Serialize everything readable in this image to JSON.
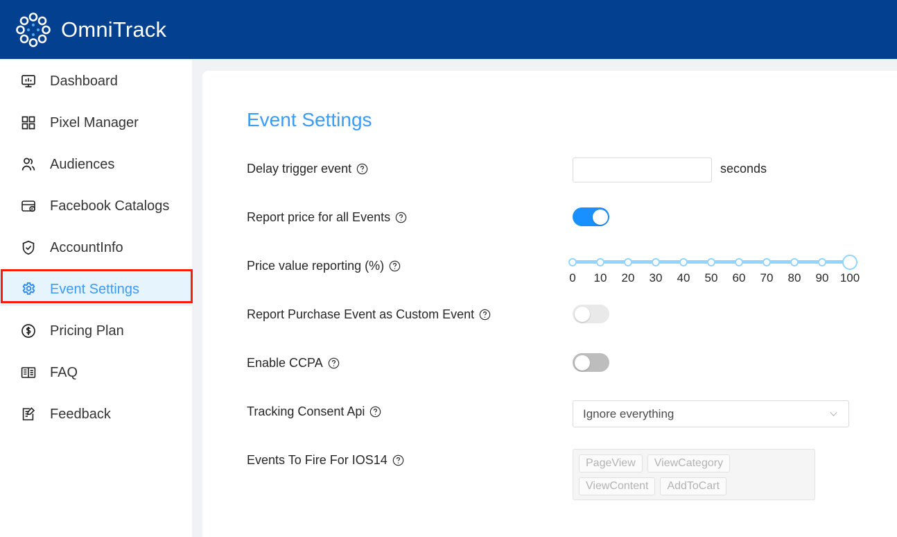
{
  "header": {
    "brand": "OmniTrack",
    "logo_icon": "dotted-ring-logo-icon",
    "bg_color": "#034190"
  },
  "sidebar": {
    "items": [
      {
        "label": "Dashboard",
        "icon": "monitor-chart-icon",
        "active": false
      },
      {
        "label": "Pixel Manager",
        "icon": "grid-squares-icon",
        "active": false
      },
      {
        "label": "Audiences",
        "icon": "people-icon",
        "active": false
      },
      {
        "label": "Facebook Catalogs",
        "icon": "catalog-facebook-icon",
        "active": false
      },
      {
        "label": "AccountInfo",
        "icon": "shield-check-icon",
        "active": false
      },
      {
        "label": "Event Settings",
        "icon": "gear-icon",
        "active": true
      },
      {
        "label": "Pricing Plan",
        "icon": "dollar-circle-icon",
        "active": false
      },
      {
        "label": "FAQ",
        "icon": "open-book-icon",
        "active": false
      },
      {
        "label": "Feedback",
        "icon": "edit-note-icon",
        "active": false
      }
    ],
    "active_highlight_color": "#e6f4fd",
    "active_text_color": "#3b9bf5",
    "annotation_box_color": "#fc1b08"
  },
  "main": {
    "title": "Event Settings",
    "title_color": "#3b9bf5",
    "rows": {
      "delay_trigger": {
        "label": "Delay trigger event",
        "help_icon": "question-circle-icon",
        "input_value": "",
        "input_placeholder": "",
        "suffix": "seconds"
      },
      "report_price": {
        "label": "Report price for all Events",
        "help_icon": "question-circle-icon",
        "toggle_state": "on",
        "toggle_color": "#1890ff"
      },
      "price_value_reporting": {
        "label": "Price value reporting (%)",
        "help_icon": "question-circle-icon",
        "value": 100,
        "min": 0,
        "max": 100,
        "step": 10,
        "marks": [
          "0",
          "10",
          "20",
          "30",
          "40",
          "50",
          "60",
          "70",
          "80",
          "90",
          "100"
        ],
        "track_color": "#91d5ff"
      },
      "report_purchase_custom": {
        "label": "Report Purchase Event as Custom Event",
        "help_icon": "question-circle-icon",
        "toggle_state": "off",
        "toggle_color": "#e9e9e9"
      },
      "enable_ccpa": {
        "label": "Enable CCPA",
        "help_icon": "question-circle-icon",
        "toggle_state": "off",
        "toggle_color": "#bdbdbd"
      },
      "tracking_consent_api": {
        "label": "Tracking Consent Api",
        "help_icon": "question-circle-icon",
        "selected_value": "Ignore everything",
        "arrow_icon": "chevron-down-icon"
      },
      "events_to_fire_ios14": {
        "label": "Events To Fire For IOS14",
        "help_icon": "question-circle-icon",
        "chips": [
          "PageView",
          "ViewCategory",
          "ViewContent",
          "AddToCart"
        ],
        "arrow_icon": "chevron-down-icon"
      }
    }
  }
}
